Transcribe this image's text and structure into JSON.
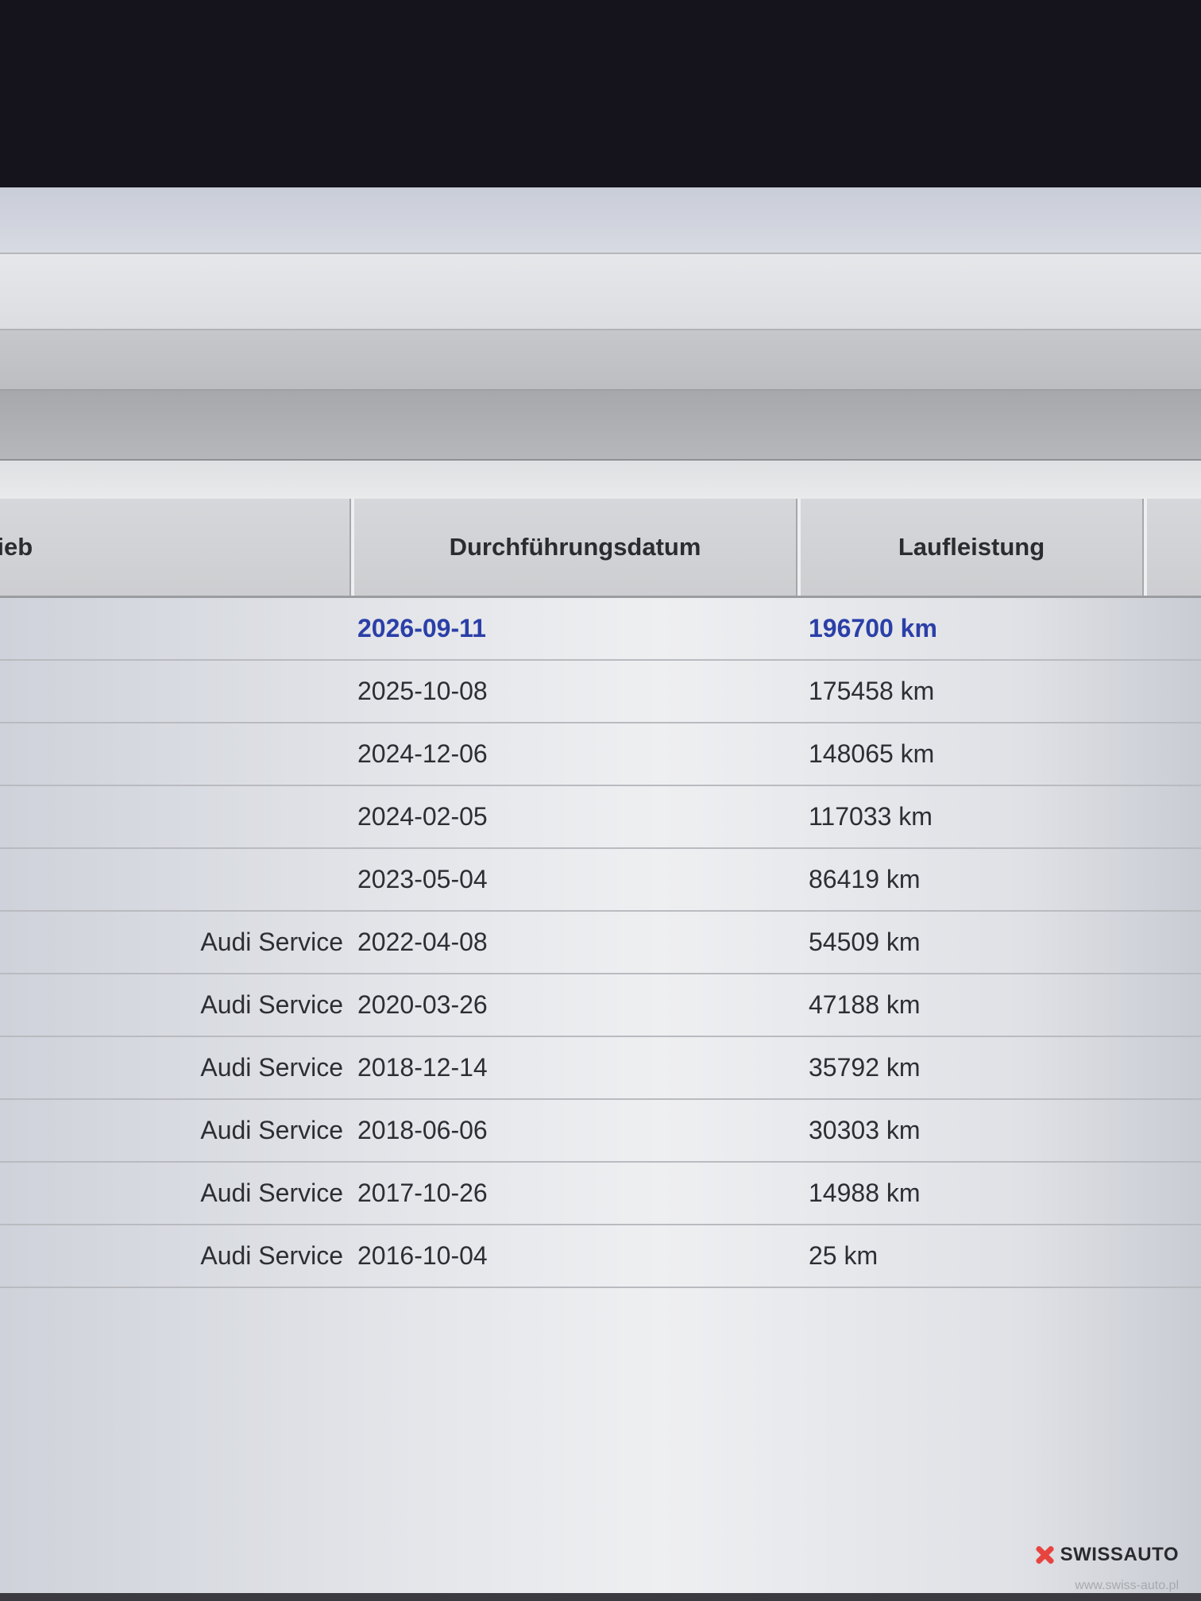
{
  "table": {
    "columns": {
      "betrieb": "trieb",
      "date": "Durchführungsdatum",
      "mileage": "Laufleistung"
    },
    "rows": [
      {
        "betrieb": "",
        "date": "2026-09-11",
        "mileage": "196700 km",
        "status": "upcoming"
      },
      {
        "betrieb": "",
        "date": "2025-10-08",
        "mileage": "175458 km"
      },
      {
        "betrieb": "",
        "date": "2024-12-06",
        "mileage": "148065 km"
      },
      {
        "betrieb": "",
        "date": "2024-02-05",
        "mileage": "117033 km"
      },
      {
        "betrieb": "",
        "date": "2023-05-04",
        "mileage": "86419 km"
      },
      {
        "betrieb": "Audi Service",
        "date": "2022-04-08",
        "mileage": "54509 km"
      },
      {
        "betrieb": "Audi Service",
        "date": "2020-03-26",
        "mileage": "47188 km"
      },
      {
        "betrieb": "Audi Service",
        "date": "2018-12-14",
        "mileage": "35792 km"
      },
      {
        "betrieb": "Audi Service",
        "date": "2018-06-06",
        "mileage": "30303 km"
      },
      {
        "betrieb": "Audi Service",
        "date": "2017-10-26",
        "mileage": "14988 km"
      },
      {
        "betrieb": "Audi Service",
        "date": "2016-10-04",
        "mileage": "25 km"
      }
    ]
  },
  "watermark": {
    "brand": "SWISSAUTO",
    "url": "www.swiss-auto.pl",
    "icon": "x-mark-icon"
  },
  "colors": {
    "upcoming_text": "#2b3fa8",
    "watermark_accent": "#e8443f"
  }
}
